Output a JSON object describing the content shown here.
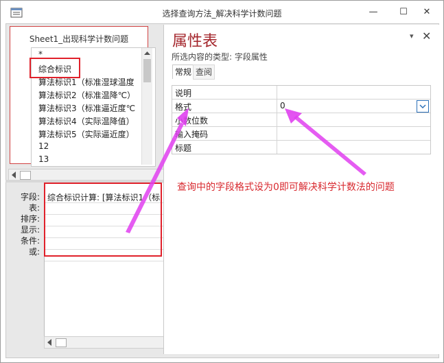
{
  "window": {
    "title": "选择查询方法_解决科学计数问题",
    "minimize_glyph": "—",
    "maximize_glyph": "☐",
    "close_glyph": "✕"
  },
  "table_pane": {
    "table_name": "Sheet1_出现科学计数问题",
    "fields": [
      "*",
      "综合标识",
      "算法标识1（标准湿球温度",
      "算法标识2（标准温降℃）",
      "算法标识3（标准逼近度℃",
      "算法标识4（实际温降值）",
      "算法标识5（实际逼近度）",
      "12",
      "13"
    ]
  },
  "design_grid": {
    "row_labels": [
      "字段:",
      "表:",
      "排序:",
      "显示:",
      "条件:",
      "或:"
    ],
    "field_cell": "综合标识计算: [算法标识1（标"
  },
  "property_sheet": {
    "title": "属性表",
    "selection_type": "所选内容的类型: 字段属性",
    "tabs": [
      "常规",
      "查阅"
    ],
    "properties": [
      {
        "name": "说明",
        "value": ""
      },
      {
        "name": "格式",
        "value": "0"
      },
      {
        "name": "小数位数",
        "value": ""
      },
      {
        "name": "输入掩码",
        "value": ""
      },
      {
        "name": "标题",
        "value": ""
      }
    ],
    "menu_glyph": "▾",
    "close_glyph": "✕"
  },
  "annotation": {
    "text": "查询中的字段格式设为0即可解决科学计数法的问题",
    "color": "#d8282e",
    "arrow_color": "#e040f0"
  },
  "icons": [
    "app-icon",
    "chevron-down-icon",
    "close-icon",
    "scroll-left-icon",
    "scroll-up-icon"
  ]
}
